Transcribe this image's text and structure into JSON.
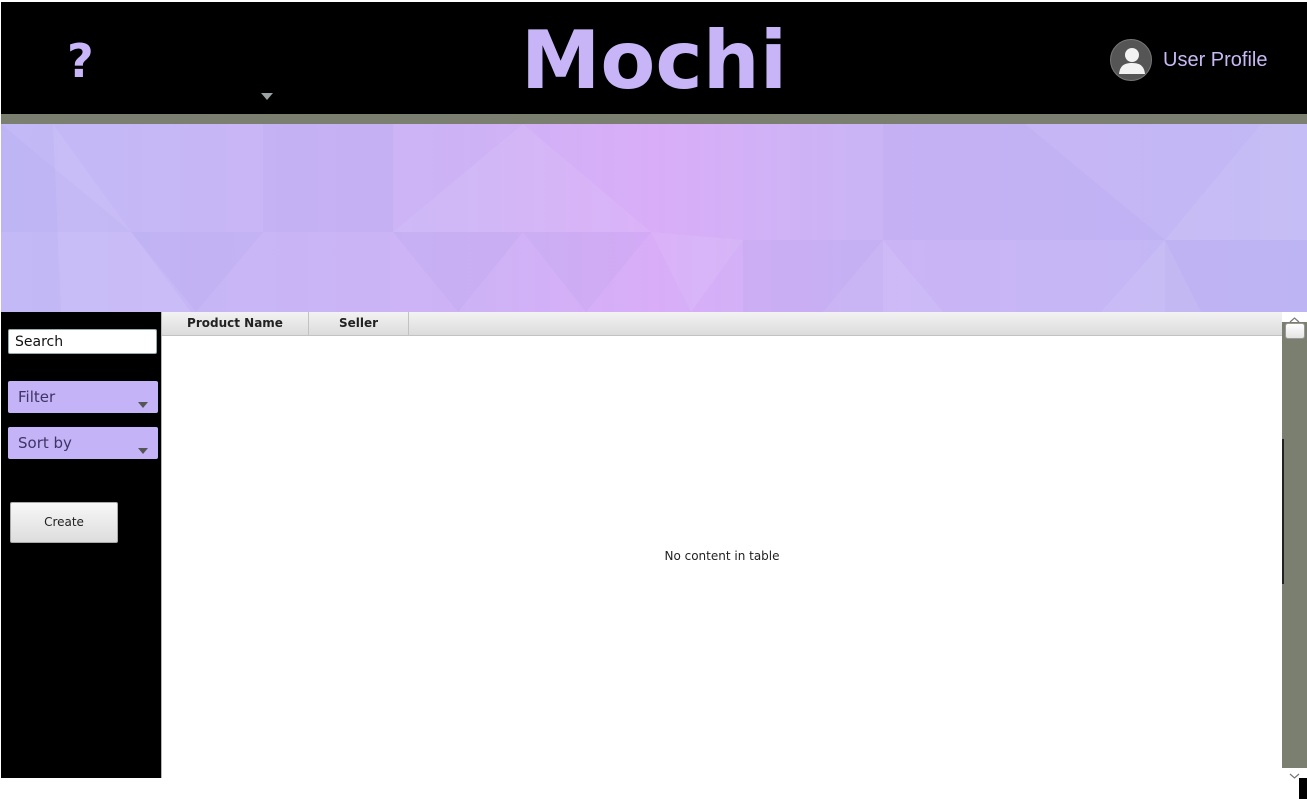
{
  "header": {
    "help_icon": "question-mark",
    "help_glyph": "?",
    "menu_dropdown_icon": "triangle-down",
    "title": "Mochi",
    "user_profile": {
      "icon": "user-silhouette",
      "label": "User Profile"
    }
  },
  "sidebar": {
    "search": {
      "value": "Search"
    },
    "filter": {
      "label": "Filter"
    },
    "sort": {
      "label": "Sort by"
    },
    "create_button": "Create"
  },
  "table": {
    "columns": [
      "Product Name",
      "Seller"
    ],
    "rows": [],
    "empty_message": "No content in table"
  },
  "colors": {
    "accent": "#c7b5f8",
    "header_bg": "#000000",
    "divider": "#7a7f70",
    "select_bg": "#c4b3f7"
  }
}
